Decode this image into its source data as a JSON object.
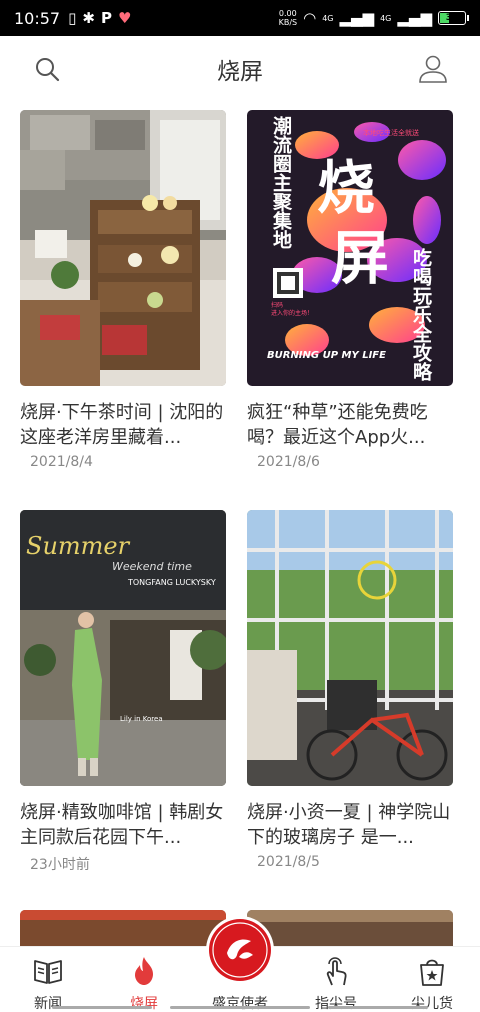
{
  "status_bar": {
    "time": "10:57",
    "speed_value": "0.00",
    "speed_unit": "KB/S",
    "signal1": "4G",
    "signal2": "4G",
    "battery": "39",
    "battery_level": 0.39
  },
  "header": {
    "title": "烧屏"
  },
  "cards": [
    {
      "caption": "烧屏·下午茶时间 | 沈阳的这座老洋房里藏着...",
      "date": "2021/8/4"
    },
    {
      "caption": "疯狂“种草”还能免费吃喝？最近这个App火...",
      "date": "2021/8/6",
      "poster": {
        "vertical_left": "潮流圈主聚集地",
        "top_right": "本地吃生活全就送",
        "big1": "烧",
        "big2": "屏",
        "vertical_right": "吃喝玩乐全攻略",
        "scan": "扫码\n进入你的主场！",
        "footer": "BURNING UP MY LIFE"
      }
    },
    {
      "caption": "烧屏·精致咖啡馆 | 韩剧女主同款后花园下午...",
      "date": "23小时前",
      "photo_text": {
        "script": "Summer",
        "script2": "Weekend time",
        "sign": "TONGFANG LUCKYSKY",
        "small": "Lily in Korea"
      }
    },
    {
      "caption": "烧屏·小资一夏 | 神学院山下的玻璃房子 是一...",
      "date": "2021/8/5"
    }
  ],
  "tabs": [
    {
      "label": "新闻",
      "icon": "newspaper-icon"
    },
    {
      "label": "烧屏",
      "icon": "flame-icon",
      "active": true
    },
    {
      "label": "盛京使者",
      "icon": "volunteer-badge-icon"
    },
    {
      "label": "指尖号",
      "icon": "finger-tap-icon"
    },
    {
      "label": "尖儿货",
      "icon": "shopping-bag-icon"
    }
  ],
  "colors": {
    "accent": "#e23b3b",
    "badge": "#d7191f"
  }
}
